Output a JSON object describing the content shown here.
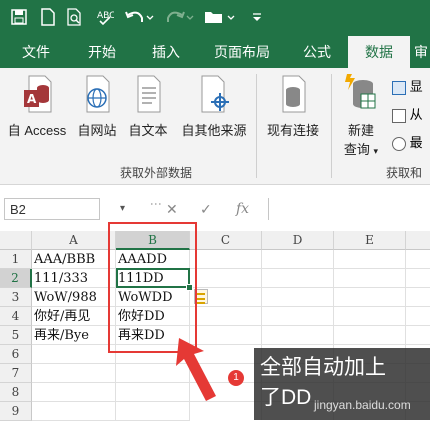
{
  "ribbon_tabs": [
    "文件",
    "开始",
    "插入",
    "页面布局",
    "公式",
    "数据",
    "审"
  ],
  "active_tab": "数据",
  "get_external": {
    "access": "自 Access",
    "web": "自网站",
    "text": "自文本",
    "other": "自其他来源",
    "group_label": "获取外部数据"
  },
  "existing": "现有连接",
  "new_query": {
    "line1": "新建",
    "line2": "查询"
  },
  "right_items": [
    "显",
    "从",
    "最"
  ],
  "right_group_label": "获取和",
  "name_box": "B2",
  "fx_label": "fx",
  "columns": [
    "A",
    "B",
    "C",
    "D",
    "E"
  ],
  "rows": [
    "1",
    "2",
    "3",
    "4",
    "5",
    "6",
    "7",
    "8",
    "9"
  ],
  "col_a": [
    "AAA/BBB",
    "111/333",
    "WoW/988",
    "你好/再见",
    "再来/Bye"
  ],
  "col_b": [
    "AAADD",
    "111DD",
    "WoWDD",
    "你好DD",
    "再来DD"
  ],
  "annotation": {
    "badge": "1",
    "text_line1": "全部自动加上",
    "text_line2": "了DD"
  },
  "watermark": "jingyan.baidu.com",
  "colors": {
    "excel_green": "#217346",
    "highlight_red": "#e53935",
    "badge_red": "#e53935"
  }
}
